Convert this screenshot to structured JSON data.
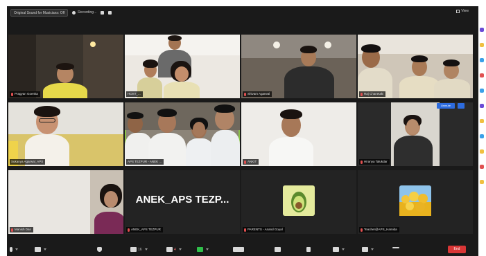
{
  "topbar": {
    "original_sound": "Original Sound for Musicians: Off",
    "recording": "Recording...",
    "view": "View"
  },
  "tiles": [
    {
      "name": "Pragyan Goenka",
      "kind": "video"
    },
    {
      "name": "HOST_...",
      "kind": "video"
    },
    {
      "name": "Shivam Agarwal",
      "kind": "video"
    },
    {
      "name": "Raj Chanetaki",
      "kind": "video"
    },
    {
      "name": "Sukanya Agarwal_APS",
      "kind": "video"
    },
    {
      "name": "APS TEZPUR - ANEK ...",
      "kind": "video"
    },
    {
      "name": "ANKIT",
      "kind": "video"
    },
    {
      "name": "Hiranya Talukdar",
      "kind": "video"
    },
    {
      "name": "Manish Das",
      "kind": "video"
    },
    {
      "name": "ANEK_APS TEZPUR",
      "kind": "name",
      "big": "ANEK_APS  TEZP..."
    },
    {
      "name": "PARENTS - Anand Goyal",
      "kind": "avatar"
    },
    {
      "name": "Teacher@APS_Hamida",
      "kind": "avatar"
    }
  ],
  "unmute": "Unmute",
  "toolbar": {
    "participants_count": "16",
    "chat_count": "4",
    "end": "End"
  },
  "colors": {
    "active_speaker": "#8bc34a",
    "end_button": "#d93636",
    "unmute_button": "#2d6cdf"
  }
}
